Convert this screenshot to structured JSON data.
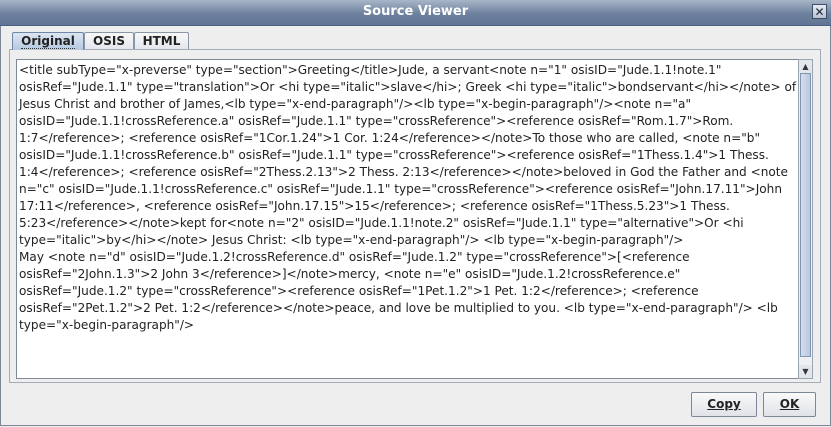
{
  "window": {
    "title": "Source Viewer",
    "close_glyph": "✕"
  },
  "tabs": [
    {
      "label": "Original",
      "active": true
    },
    {
      "label": "OSIS",
      "active": false
    },
    {
      "label": "HTML",
      "active": false
    }
  ],
  "source_text": "<title subType=\"x-preverse\" type=\"section\">Greeting</title>Jude, a servant<note n=\"1\" osisID=\"Jude.1.1!note.1\" osisRef=\"Jude.1.1\" type=\"translation\">Or <hi type=\"italic\">slave</hi>; Greek <hi type=\"italic\">bondservant</hi></note> of Jesus Christ and brother of James,<lb type=\"x-end-paragraph\"/><lb type=\"x-begin-paragraph\"/><note n=\"a\" osisID=\"Jude.1.1!crossReference.a\" osisRef=\"Jude.1.1\" type=\"crossReference\"><reference osisRef=\"Rom.1.7\">Rom. 1:7</reference>; <reference osisRef=\"1Cor.1.24\">1 Cor. 1:24</reference></note>To those who are called, <note n=\"b\" osisID=\"Jude.1.1!crossReference.b\" osisRef=\"Jude.1.1\" type=\"crossReference\"><reference osisRef=\"1Thess.1.4\">1 Thess. 1:4</reference>; <reference osisRef=\"2Thess.2.13\">2 Thess. 2:13</reference></note>beloved in God the Father and <note n=\"c\" osisID=\"Jude.1.1!crossReference.c\" osisRef=\"Jude.1.1\" type=\"crossReference\"><reference osisRef=\"John.17.11\">John 17:11</reference>, <reference osisRef=\"John.17.15\">15</reference>; <reference osisRef=\"1Thess.5.23\">1 Thess. 5:23</reference></note>kept for<note n=\"2\" osisID=\"Jude.1.1!note.2\" osisRef=\"Jude.1.1\" type=\"alternative\">Or <hi type=\"italic\">by</hi></note> Jesus Christ: <lb type=\"x-end-paragraph\"/> <lb type=\"x-begin-paragraph\"/>\nMay <note n=\"d\" osisID=\"Jude.1.2!crossReference.d\" osisRef=\"Jude.1.2\" type=\"crossReference\">[<reference osisRef=\"2John.1.3\">2 John 3</reference>]</note>mercy, <note n=\"e\" osisID=\"Jude.1.2!crossReference.e\" osisRef=\"Jude.1.2\" type=\"crossReference\"><reference osisRef=\"1Pet.1.2\">1 Pet. 1:2</reference>; <reference osisRef=\"2Pet.1.2\">2 Pet. 1:2</reference></note>peace, and love be multiplied to you. <lb type=\"x-end-paragraph\"/> <lb type=\"x-begin-paragraph\"/>",
  "scrollbar": {
    "up_glyph": "▲",
    "down_glyph": "▼"
  },
  "buttons": {
    "copy_label": "Copy",
    "ok_label": "OK"
  }
}
